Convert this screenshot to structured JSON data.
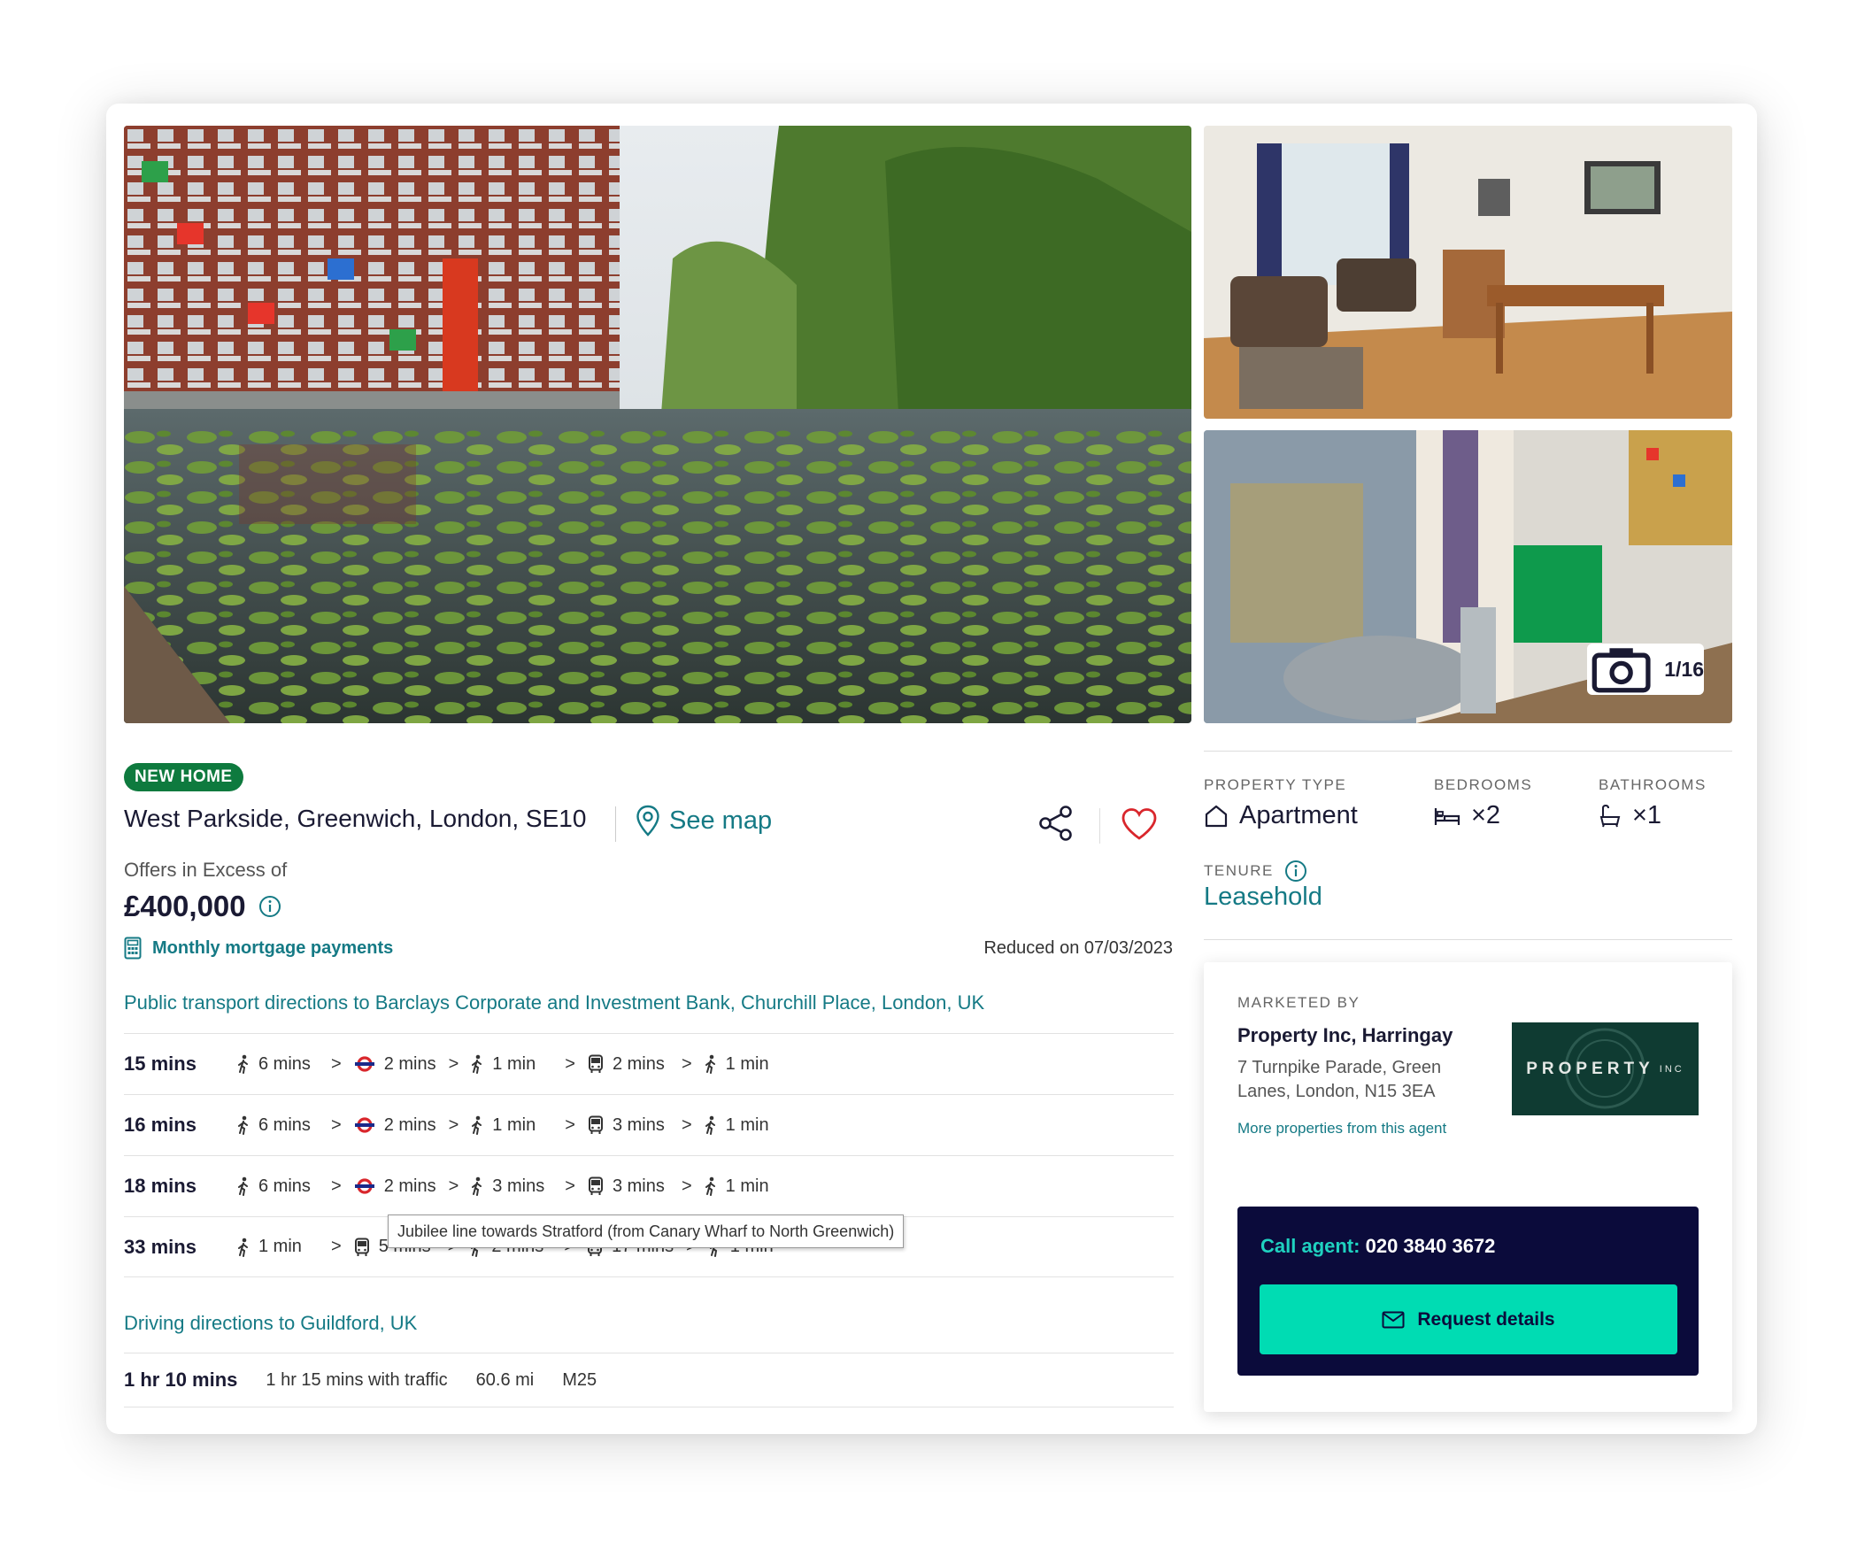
{
  "photos": {
    "counter": "1/16",
    "main_alt": "Canal with lily pads beside apartment buildings",
    "top_alt": "Living room and dining area",
    "bottom_alt": "Balcony with table and chair"
  },
  "listing": {
    "badge": "NEW HOME",
    "address": "West Parkside, Greenwich, London, SE10",
    "see_map": "See map",
    "price_label": "Offers in Excess of",
    "price": "£400,000",
    "mortgage_link": "Monthly mortgage payments",
    "reduced": "Reduced on 07/03/2023"
  },
  "transport": {
    "title": "Public transport directions to Barclays Corporate and Investment Bank, Churchill Place, London, UK",
    "routes": [
      {
        "total": "15 mins",
        "legs": [
          {
            "icon": "walk",
            "time": "6 mins"
          },
          {
            "icon": "tube",
            "time": "2 mins"
          },
          {
            "icon": "walk",
            "time": "1 min"
          },
          {
            "icon": "bus",
            "time": "2 mins"
          },
          {
            "icon": "walk",
            "time": "1 min"
          }
        ]
      },
      {
        "total": "16 mins",
        "legs": [
          {
            "icon": "walk",
            "time": "6 mins"
          },
          {
            "icon": "tube",
            "time": "2 mins"
          },
          {
            "icon": "walk",
            "time": "1 min"
          },
          {
            "icon": "bus",
            "time": "3 mins"
          },
          {
            "icon": "walk",
            "time": "1 min"
          }
        ]
      },
      {
        "total": "18 mins",
        "legs": [
          {
            "icon": "walk",
            "time": "6 mins"
          },
          {
            "icon": "tube",
            "time": "2 mins"
          },
          {
            "icon": "walk",
            "time": "3 mins"
          },
          {
            "icon": "bus",
            "time": "3 mins"
          },
          {
            "icon": "walk",
            "time": "1 min"
          }
        ]
      },
      {
        "total": "33 mins",
        "legs": [
          {
            "icon": "walk",
            "time": "1 min"
          },
          {
            "icon": "bus",
            "time": "5 mins"
          },
          {
            "icon": "walk",
            "time": "2 mins"
          },
          {
            "icon": "bus",
            "time": "17 mins"
          },
          {
            "icon": "walk",
            "time": "1 min"
          }
        ]
      }
    ],
    "tooltip": "Jubilee line towards Stratford (from Canary Wharf to North Greenwich)"
  },
  "driving": {
    "title": "Driving directions to Guildford, UK",
    "total": "1 hr 10 mins",
    "traffic": "1 hr 15 mins with traffic",
    "distance": "60.6 mi",
    "road": "M25"
  },
  "facts": {
    "property_type_label": "PROPERTY TYPE",
    "property_type": "Apartment",
    "bedrooms_label": "BEDROOMS",
    "bedrooms": "×2",
    "bathrooms_label": "BATHROOMS",
    "bathrooms": "×1",
    "tenure_label": "TENURE",
    "tenure": "Leasehold"
  },
  "agent": {
    "label": "MARKETED BY",
    "name": "Property Inc, Harringay",
    "address": "7 Turnpike Parade, Green Lanes, London, N15 3EA",
    "more_link": "More properties from this agent",
    "logo_text": "PROPERTY",
    "logo_suffix": "INC",
    "call_label": "Call agent:",
    "phone": "020 3840 3672",
    "request_button": "Request details"
  },
  "colors": {
    "accent_teal": "#157a85",
    "badge_green": "#0e7a3e",
    "cta_green": "#00dcb3",
    "navy": "#0b0b3b",
    "heart_red": "#d9262c"
  }
}
